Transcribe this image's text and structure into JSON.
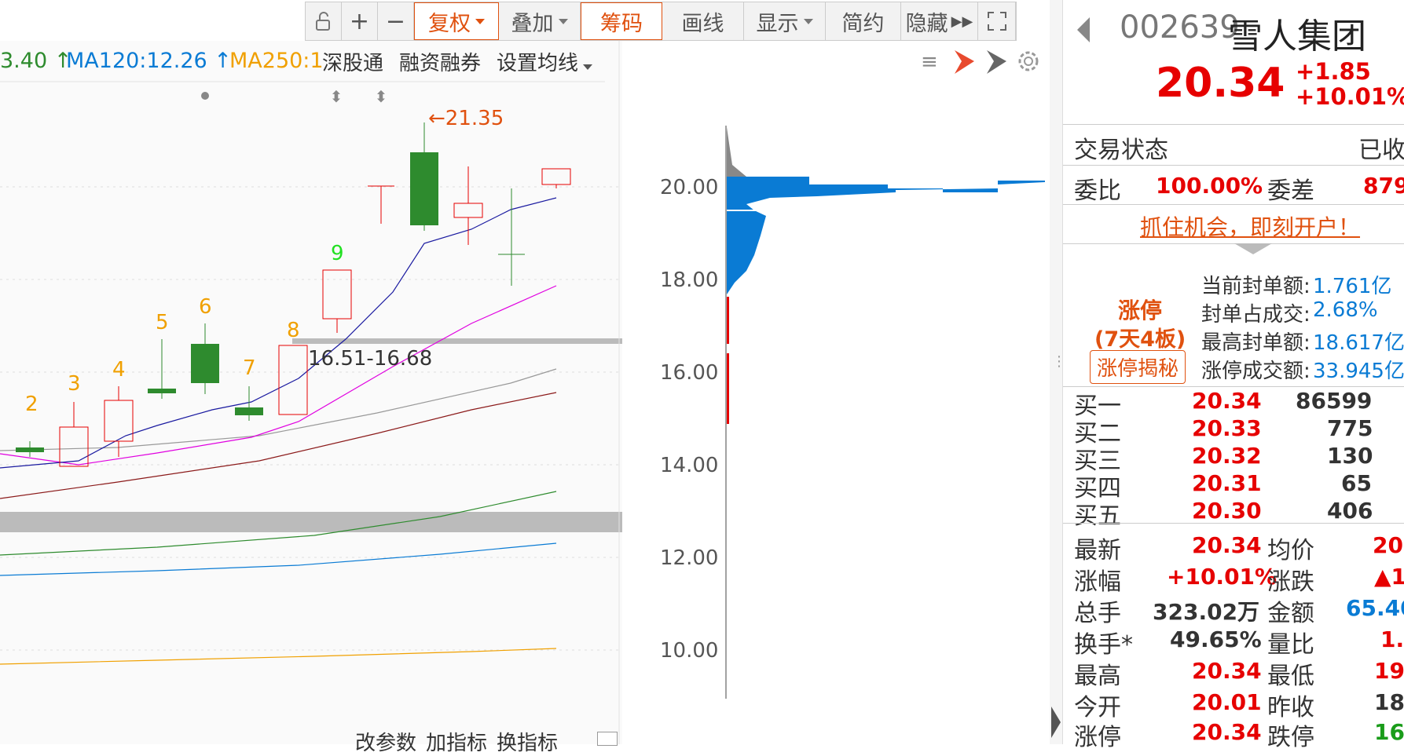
{
  "toolbar": {
    "items": [
      "复权",
      "叠加",
      "筹码",
      "画线",
      "显示",
      "简约",
      "隐藏"
    ]
  },
  "ma_labels": {
    "ma_a": "3.40",
    "ma120": "MA120:12.26",
    "ma250": "MA250:1"
  },
  "sub_links": [
    "深股通",
    "融资融券",
    "设置均线"
  ],
  "chart": {
    "high_label": "21.35",
    "range_label": "16.51-16.68",
    "count_labels": [
      "2",
      "3",
      "4",
      "5",
      "6",
      "7",
      "8",
      "9"
    ],
    "price_ticks": [
      "20.00",
      "18.00",
      "16.00",
      "14.00",
      "12.00",
      "10.00"
    ],
    "bottom_links": [
      "改参数",
      "加指标",
      "换指标"
    ]
  },
  "stock": {
    "code": "002639",
    "name": "雪人集团",
    "price": "20.34",
    "change": "+1.85",
    "change_pct": "+10.01%"
  },
  "status": {
    "label": "交易状态",
    "value": "已收"
  },
  "ratio": {
    "wb_label": "委比",
    "wb_value": "100.00%",
    "wc_label": "委差",
    "wc_value": "879"
  },
  "promo": "抓住机会，即刻开户！",
  "limit_up": {
    "title": "涨停",
    "sub": "(7天4板)",
    "button": "涨停揭秘",
    "rows": [
      {
        "label": "当前封单额:",
        "value": "1.761亿"
      },
      {
        "label": "封单占成交:",
        "value": "2.68%"
      },
      {
        "label": "最高封单额:",
        "value": "18.617亿"
      },
      {
        "label": "涨停成交额:",
        "value": "33.945亿"
      }
    ]
  },
  "bids": [
    {
      "label": "买一",
      "price": "20.34",
      "vol": "86599"
    },
    {
      "label": "买二",
      "price": "20.33",
      "vol": "775"
    },
    {
      "label": "买三",
      "price": "20.32",
      "vol": "130"
    },
    {
      "label": "买四",
      "price": "20.31",
      "vol": "65"
    },
    {
      "label": "买五",
      "price": "20.30",
      "vol": "406"
    }
  ],
  "quote": [
    {
      "l1": "最新",
      "v1": "20.34",
      "l2": "均价",
      "v2": "20."
    },
    {
      "l1": "涨幅",
      "v1": "+10.01%",
      "l2": "涨跌",
      "v2": "▲1."
    },
    {
      "l1": "总手",
      "v1": "323.02万",
      "l2": "金额",
      "v2": "65.40"
    },
    {
      "l1": "换手*",
      "v1": "49.65%",
      "l2": "量比",
      "v2": "1."
    },
    {
      "l1": "最高",
      "v1": "20.34",
      "l2": "最低",
      "v2": "19."
    },
    {
      "l1": "今开",
      "v1": "20.01",
      "l2": "昨收",
      "v2": "18."
    },
    {
      "l1": "涨停",
      "v1": "20.34",
      "l2": "跌停",
      "v2": "16."
    }
  ],
  "colors": {
    "up": "#e60000",
    "down": "#2e8b2e",
    "accent": "#e0510f",
    "chip_blue": "#0a7bd4"
  }
}
